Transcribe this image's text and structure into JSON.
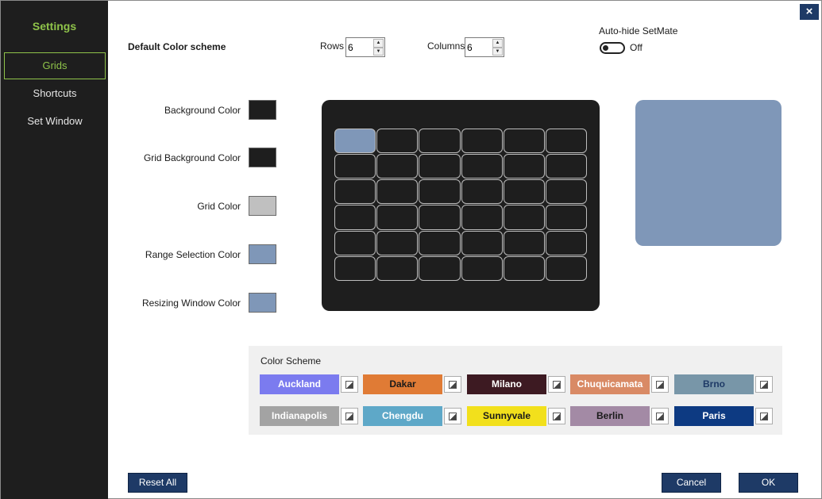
{
  "sidebar": {
    "title": "Settings",
    "items": [
      {
        "label": "Grids",
        "active": true
      },
      {
        "label": "Shortcuts",
        "active": false
      },
      {
        "label": "Set Window",
        "active": false
      }
    ]
  },
  "header": {
    "section_title": "Default Color scheme",
    "rows_label": "Rows",
    "rows_value": "6",
    "columns_label": "Columns",
    "columns_value": "6",
    "autohide_label": "Auto-hide SetMate",
    "autohide_state": "Off",
    "close_icon": "×"
  },
  "colors": [
    {
      "label": "Background Color",
      "value": "#1e1e1e"
    },
    {
      "label": "Grid Background Color",
      "value": "#1e1e1e"
    },
    {
      "label": "Grid Color",
      "value": "#c0c0c0"
    },
    {
      "label": "Range Selection Color",
      "value": "#7f97b8"
    },
    {
      "label": "Resizing Window Color",
      "value": "#7f97b8"
    }
  ],
  "preview": {
    "rows": 6,
    "columns": 6,
    "selected_cell": [
      0,
      0
    ],
    "background": "#1e1e1e",
    "grid_color": "#bdbdbd",
    "selection_color": "#7f97b8",
    "resize_color": "#7f97b8"
  },
  "color_scheme": {
    "title": "Color Scheme",
    "schemes": [
      {
        "name": "Auckland",
        "bg": "#7b7bef",
        "fg": "#ffffff"
      },
      {
        "name": "Dakar",
        "bg": "#e07b35",
        "fg": "#1a1a1a"
      },
      {
        "name": "Milano",
        "bg": "#3d1a22",
        "fg": "#ffffff"
      },
      {
        "name": "Chuquicamata",
        "bg": "#d98a65",
        "fg": "#ffffff"
      },
      {
        "name": "Brno",
        "bg": "#7896a8",
        "fg": "#1e3a66"
      },
      {
        "name": "Indianapolis",
        "bg": "#a3a3a3",
        "fg": "#ffffff"
      },
      {
        "name": "Chengdu",
        "bg": "#5ea8c8",
        "fg": "#ffffff"
      },
      {
        "name": "Sunnyvale",
        "bg": "#f2e01c",
        "fg": "#1a1a1a"
      },
      {
        "name": "Berlin",
        "bg": "#a38aa5",
        "fg": "#1a1a1a"
      },
      {
        "name": "Paris",
        "bg": "#0d3a82",
        "fg": "#ffffff"
      }
    ]
  },
  "footer": {
    "reset_label": "Reset All",
    "cancel_label": "Cancel",
    "ok_label": "OK"
  }
}
